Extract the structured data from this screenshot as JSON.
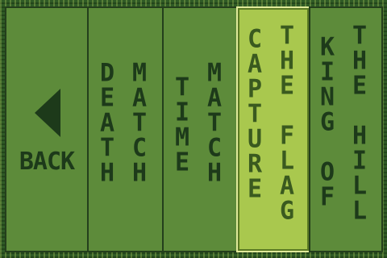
{
  "menu": {
    "back_label": "BACK",
    "selected_mode": "CAPTURE THE FLAG",
    "modes": [
      {
        "name": "DEATH MATCH",
        "words": [
          "DEATH",
          "MATCH"
        ]
      },
      {
        "name": "TIME MATCH",
        "words": [
          "TIME",
          "MATCH"
        ]
      },
      {
        "name": "CAPTURE THE FLAG",
        "words": [
          "CAPTURE",
          "THE FLAG"
        ]
      },
      {
        "name": "KING OF THE HILL",
        "words": [
          "KING OF",
          "THE HILL"
        ]
      }
    ]
  },
  "colors": {
    "panel_bg": "#5d8b3a",
    "panel_border": "#243f1c",
    "text": "#1d3a1a",
    "selected_bg": "#a9c84e",
    "selected_border": "#dfe99a"
  }
}
